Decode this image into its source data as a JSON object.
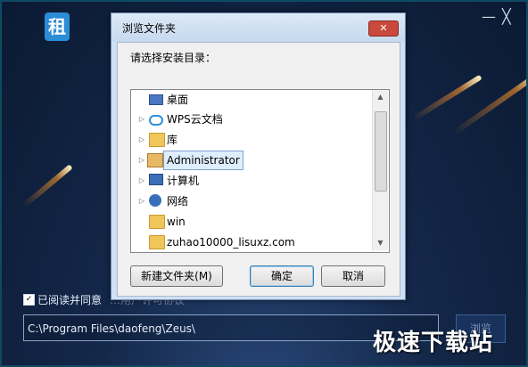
{
  "app": {
    "logo_text": "租",
    "minimize_glyph": "—",
    "close_glyph": "╳",
    "agree_label": "已阅读并同意",
    "agree_faded": "…用户许可协议",
    "agree_checked": true,
    "install_path": "C:\\Program Files\\daofeng\\Zeus\\",
    "browse_label": "浏览",
    "watermark": "极速下载站"
  },
  "dialog": {
    "title": "浏览文件夹",
    "close_glyph": "✕",
    "prompt": "请选择安装目录：",
    "tree": [
      {
        "label": "桌面",
        "icon": "desktop-icon",
        "expander": ""
      },
      {
        "label": "WPS云文档",
        "icon": "cloud-icon",
        "expander": "▷"
      },
      {
        "label": "库",
        "icon": "library-folder-icon",
        "expander": "▷"
      },
      {
        "label": "Administrator",
        "icon": "user-folder-icon",
        "expander": "▷",
        "selected": true
      },
      {
        "label": "计算机",
        "icon": "computer-icon",
        "expander": "▷"
      },
      {
        "label": "网络",
        "icon": "network-icon",
        "expander": "▷"
      },
      {
        "label": "win",
        "icon": "folder-icon",
        "expander": ""
      },
      {
        "label": "zuhao10000_lisuxz.com",
        "icon": "folder-icon",
        "expander": ""
      }
    ],
    "scroll_up": "▲",
    "scroll_down": "▼",
    "new_folder_label": "新建文件夹(M)",
    "ok_label": "确定",
    "cancel_label": "取消"
  }
}
